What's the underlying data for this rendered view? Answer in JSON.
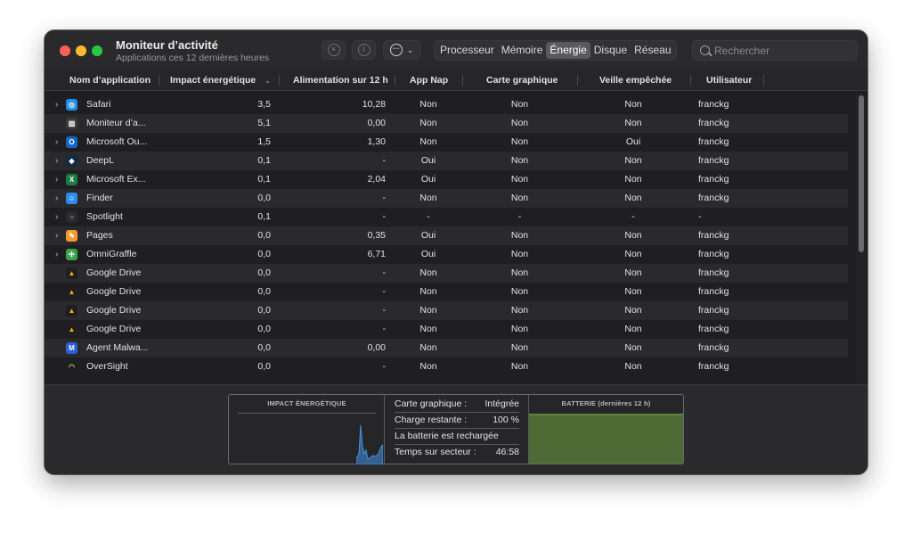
{
  "window": {
    "title": "Moniteur d’activité",
    "subtitle": "Applications ces 12 dernières heures"
  },
  "toolbar": {
    "stop_icon": "xmark-circle-icon",
    "info_icon": "info-circle-icon",
    "more_icon": "ellipsis-circle-icon",
    "tabs": [
      "Processeur",
      "Mémoire",
      "Énergie",
      "Disque",
      "Réseau"
    ],
    "active_tab": "Énergie",
    "search_placeholder": "Rechercher"
  },
  "table": {
    "columns": [
      "Nom d’application",
      "Impact énergétique",
      "Alimentation sur 12 h",
      "App Nap",
      "Carte graphique",
      "Veille empêchée",
      "Utilisateur"
    ],
    "sorted_column": "Impact énergétique",
    "rows": [
      {
        "name": "Safari",
        "expandable": true,
        "impact": "3,5",
        "power": "10,28",
        "appnap": "Non",
        "gpu": "Non",
        "sleep": "Non",
        "user": "franckg",
        "icon": "compass-icon",
        "color": "#1f8ef1"
      },
      {
        "name": "Moniteur d’a...",
        "expandable": false,
        "impact": "5,1",
        "power": "0,00",
        "appnap": "Non",
        "gpu": "Non",
        "sleep": "Non",
        "user": "franckg",
        "icon": "activity-monitor-icon",
        "color": "#3b3b3b"
      },
      {
        "name": "Microsoft Ou...",
        "expandable": true,
        "impact": "1,5",
        "power": "1,30",
        "appnap": "Non",
        "gpu": "Non",
        "sleep": "Oui",
        "user": "franckg",
        "icon": "outlook-icon",
        "color": "#1466c8"
      },
      {
        "name": "DeepL",
        "expandable": true,
        "impact": "0,1",
        "power": "-",
        "appnap": "Oui",
        "gpu": "Non",
        "sleep": "Non",
        "user": "franckg",
        "icon": "deepl-icon",
        "color": "#0f2b46"
      },
      {
        "name": "Microsoft Ex...",
        "expandable": true,
        "impact": "0,1",
        "power": "2,04",
        "appnap": "Oui",
        "gpu": "Non",
        "sleep": "Non",
        "user": "franckg",
        "icon": "excel-icon",
        "color": "#1d7a43"
      },
      {
        "name": "Finder",
        "expandable": true,
        "impact": "0,0",
        "power": "-",
        "appnap": "Non",
        "gpu": "Non",
        "sleep": "Non",
        "user": "franckg",
        "icon": "finder-icon",
        "color": "#2a8cf0"
      },
      {
        "name": "Spotlight",
        "expandable": true,
        "impact": "0,1",
        "power": "-",
        "appnap": "-",
        "gpu": "-",
        "sleep": "-",
        "user": "-",
        "icon": "magnifier-icon",
        "color": "#2b2b2d"
      },
      {
        "name": "Pages",
        "expandable": true,
        "impact": "0,0",
        "power": "0,35",
        "appnap": "Oui",
        "gpu": "Non",
        "sleep": "Non",
        "user": "franckg",
        "icon": "pages-icon",
        "color": "#f39a2b"
      },
      {
        "name": "OmniGraffle",
        "expandable": true,
        "impact": "0,0",
        "power": "6,71",
        "appnap": "Oui",
        "gpu": "Non",
        "sleep": "Non",
        "user": "franckg",
        "icon": "omnigraffle-icon",
        "color": "#3aa34a"
      },
      {
        "name": "Google Drive",
        "expandable": false,
        "impact": "0,0",
        "power": "-",
        "appnap": "Non",
        "gpu": "Non",
        "sleep": "Non",
        "user": "franckg",
        "icon": "google-drive-icon",
        "color": "#1f1f21"
      },
      {
        "name": "Google Drive",
        "expandable": false,
        "impact": "0,0",
        "power": "-",
        "appnap": "Non",
        "gpu": "Non",
        "sleep": "Non",
        "user": "franckg",
        "icon": "google-drive-icon",
        "color": "#1f1f21"
      },
      {
        "name": "Google Drive",
        "expandable": false,
        "impact": "0,0",
        "power": "-",
        "appnap": "Non",
        "gpu": "Non",
        "sleep": "Non",
        "user": "franckg",
        "icon": "google-drive-icon",
        "color": "#1f1f21"
      },
      {
        "name": "Google Drive",
        "expandable": false,
        "impact": "0,0",
        "power": "-",
        "appnap": "Non",
        "gpu": "Non",
        "sleep": "Non",
        "user": "franckg",
        "icon": "google-drive-icon",
        "color": "#1f1f21"
      },
      {
        "name": "Agent Malwa...",
        "expandable": false,
        "impact": "0,0",
        "power": "0,00",
        "appnap": "Non",
        "gpu": "Non",
        "sleep": "Non",
        "user": "franckg",
        "icon": "malwarebytes-icon",
        "color": "#2c5fd6"
      },
      {
        "name": "OverSight",
        "expandable": false,
        "impact": "0,0",
        "power": "-",
        "appnap": "Non",
        "gpu": "Non",
        "sleep": "Non",
        "user": "franckg",
        "icon": "oversight-icon",
        "color": "#1f1f21"
      }
    ]
  },
  "footer": {
    "impact_title": "IMPACT ÉNERGÉTIQUE",
    "battery_title": "BATTERIE (dernières 12 h)",
    "stats": [
      {
        "label": "Carte graphique :",
        "value": "Intégrée"
      },
      {
        "label": "Charge restante :",
        "value": "100 %"
      },
      {
        "label": "La batterie est rechargée",
        "value": ""
      },
      {
        "label": "Temps sur secteur :",
        "value": "46:58"
      }
    ],
    "battery_level_percent": 100,
    "colors": {
      "impact_chart": "#4a90d9",
      "battery_fill": "#4e6b36"
    }
  }
}
